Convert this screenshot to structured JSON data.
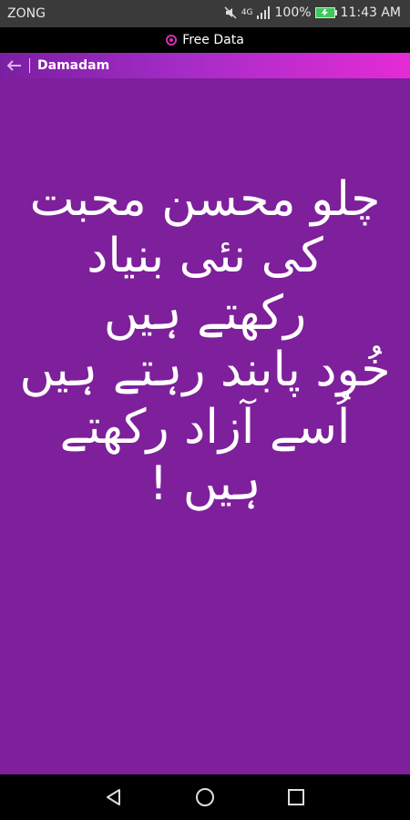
{
  "status": {
    "carrier": "ZONG",
    "network": "4G",
    "battery": "100%",
    "time": "11:43 AM",
    "icons": [
      "mute-icon",
      "signal-icon",
      "battery-icon"
    ]
  },
  "banner": {
    "label": "Free Data",
    "icon": "free-data-icon"
  },
  "app": {
    "title": "Damadam",
    "back_icon": "back-arrow-icon"
  },
  "poem": [
    "چلو محسن محبت",
    "کی نئی بنیاد",
    "رکھتے ہیں",
    "خُود پابند رہتے ہیں",
    "اُسے آزاد رکھتے",
    "ہیں !"
  ],
  "nav": [
    "back-nav-icon",
    "home-nav-icon",
    "recent-apps-nav-icon"
  ],
  "colors": {
    "background": "#7e1f9b",
    "app_bar_start": "#7a1fa2",
    "app_bar_end": "#e52bd6",
    "text": "#ffffff"
  }
}
